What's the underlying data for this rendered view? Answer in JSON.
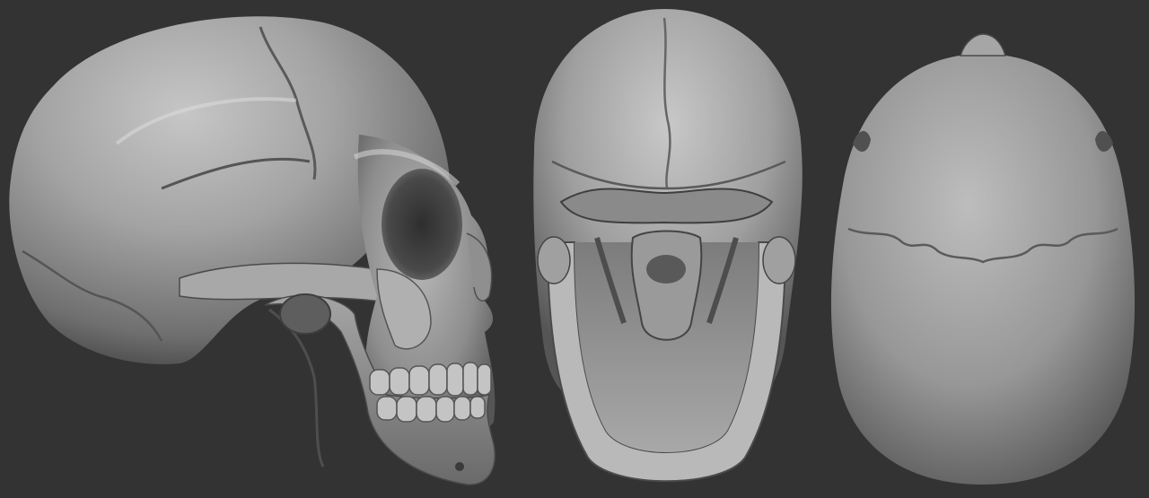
{
  "scene": {
    "background_color": "#333333",
    "material_color": "#9a9a9a",
    "highlight_color": "#c9c9c9",
    "shadow_color": "#3d3d3d",
    "views": [
      {
        "name": "side-view"
      },
      {
        "name": "bottom-view"
      },
      {
        "name": "top-view"
      }
    ]
  }
}
